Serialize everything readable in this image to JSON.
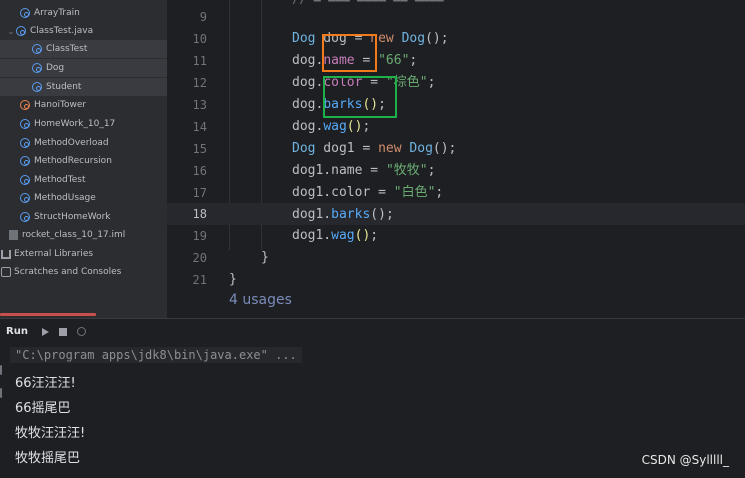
{
  "project_tree": {
    "items": [
      {
        "label": "ArrayTrain",
        "icon": "class-icon"
      },
      {
        "label": "ClassTest.java",
        "icon": "class-icon",
        "expanded": true
      },
      {
        "label": "ClassTest",
        "icon": "class-icon"
      },
      {
        "label": "Dog",
        "icon": "class-icon"
      },
      {
        "label": "Student",
        "icon": "class-icon"
      },
      {
        "label": "HanoiTower",
        "icon": "class-main-icon"
      },
      {
        "label": "HomeWork_10_17",
        "icon": "class-icon"
      },
      {
        "label": "MethodOverload",
        "icon": "class-icon"
      },
      {
        "label": "MethodRecursion",
        "icon": "class-icon"
      },
      {
        "label": "MethodTest",
        "icon": "class-icon"
      },
      {
        "label": "MethodUsage",
        "icon": "class-icon"
      },
      {
        "label": "StructHomeWork",
        "icon": "class-icon"
      },
      {
        "label": "rocket_class_10_17.iml",
        "icon": "iml-file-icon"
      },
      {
        "label": "External Libraries",
        "icon": "library-icon"
      },
      {
        "label": "Scratches and Consoles",
        "icon": "scratch-icon"
      }
    ]
  },
  "editor": {
    "line_numbers": [
      "9",
      "10",
      "11",
      "12",
      "13",
      "14",
      "15",
      "16",
      "17",
      "18",
      "19",
      "20",
      "21"
    ],
    "current_line": "18",
    "usages": "4 usages",
    "code": {
      "l9": {
        "type": "Dog",
        "var": " dog = ",
        "kw": "new",
        "cls": " Dog",
        "paren": "();"
      },
      "l10": {
        "obj": "dog.",
        "field": "name",
        "op": " = ",
        "str": "\"66\"",
        "end": ";"
      },
      "l11": {
        "obj": "dog.",
        "field": "color",
        "op": " = ",
        "str": "\"棕色\"",
        "end": ";"
      },
      "l12": {
        "obj": "dog.",
        "method": "barks",
        "paren": "()",
        "end": ";"
      },
      "l13": {
        "obj": "dog.",
        "method": "wag",
        "paren": "()",
        "end": ";"
      },
      "l14": {
        "type": "Dog",
        "var": " dog1 = ",
        "kw": "new",
        "cls": " Dog",
        "paren": "();"
      },
      "l15": {
        "obj": "dog1.",
        "field": "name",
        "op": " = ",
        "str": "\"牧牧\"",
        "end": ";"
      },
      "l16": {
        "obj": "dog1.",
        "field": "color",
        "op": " = ",
        "str": "\"白色\"",
        "end": ";"
      },
      "l17": {
        "obj": "dog1.",
        "method": "barks",
        "paren": "()",
        "end": ";"
      },
      "l18": {
        "obj": "dog1.",
        "method": "wag",
        "paren": "()",
        "end": ";"
      },
      "l19": {
        "brace": "}"
      },
      "l20": {
        "brace": "}"
      }
    }
  },
  "run_panel": {
    "tab_label": "Run",
    "command": "\"C:\\program apps\\jdk8\\bin\\java.exe\" ...",
    "output": [
      "66汪汪汪!",
      "66摇尾巴",
      "牧牧汪汪汪!",
      "牧牧摇尾巴"
    ]
  },
  "watermark": "CSDN @Sylllll_",
  "colors": {
    "annotation_orange": "#f27a1a",
    "annotation_green": "#1fb04a"
  }
}
